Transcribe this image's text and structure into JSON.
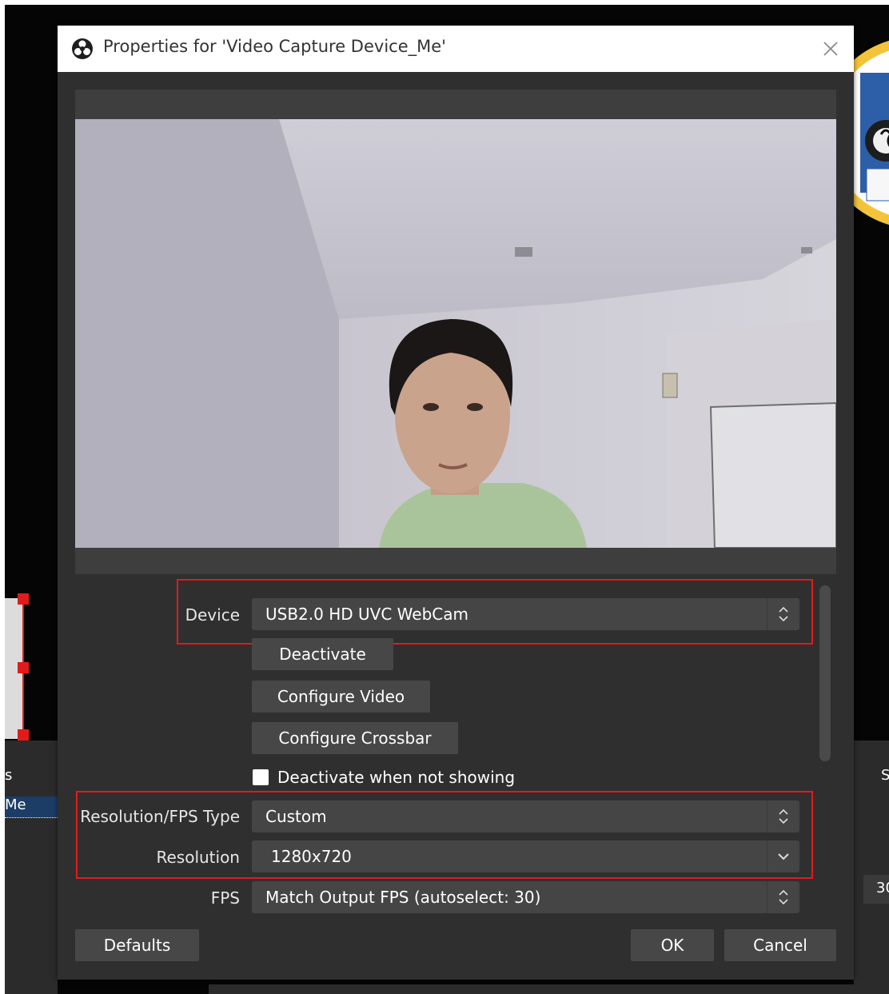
{
  "background": {
    "left_dock_header": "s",
    "left_dock_item": "Me",
    "right_dock_header": "S",
    "right_value": "30"
  },
  "dialog": {
    "title": "Properties for 'Video Capture Device_Me'",
    "close_icon": "close-icon",
    "app_icon": "obs-logo-icon"
  },
  "form": {
    "device": {
      "label": "Device",
      "value": "USB2.0 HD UVC WebCam"
    },
    "buttons": {
      "deactivate": "Deactivate",
      "configure_video": "Configure Video",
      "configure_crossbar": "Configure Crossbar"
    },
    "deactivate_when_not_showing": {
      "label": "Deactivate when not showing",
      "checked": false
    },
    "resolution_fps_type": {
      "label": "Resolution/FPS Type",
      "value": "Custom"
    },
    "resolution": {
      "label": "Resolution",
      "value": "1280x720"
    },
    "fps": {
      "label": "FPS",
      "value": "Match Output FPS (autoselect: 30)"
    }
  },
  "footer": {
    "defaults": "Defaults",
    "ok": "OK",
    "cancel": "Cancel"
  },
  "colors": {
    "highlight": "#e11b1b",
    "dialog_bg": "#2f2f2f",
    "control_bg": "#454545"
  }
}
